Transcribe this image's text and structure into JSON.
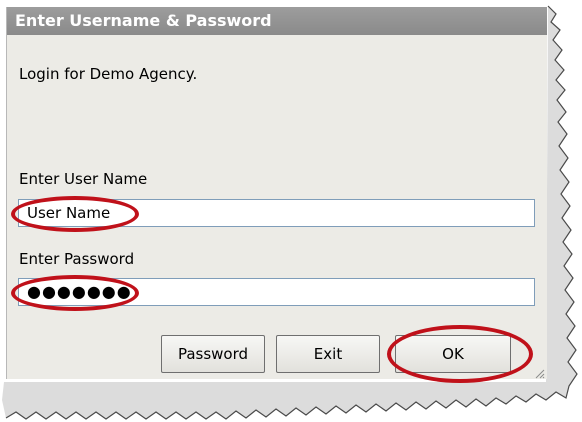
{
  "dialog": {
    "title": "Enter Username & Password",
    "message": "Login for Demo Agency."
  },
  "username": {
    "label": "Enter User Name",
    "value": "User Name"
  },
  "password": {
    "label": "Enter Password",
    "value": "●●●●●●●"
  },
  "buttons": {
    "password": "Password",
    "exit": "Exit",
    "ok": "OK"
  },
  "colors": {
    "title_bar": "#8f8f8f",
    "highlight_oval": "#c0111a",
    "dialog_bg": "#ecebe6"
  }
}
